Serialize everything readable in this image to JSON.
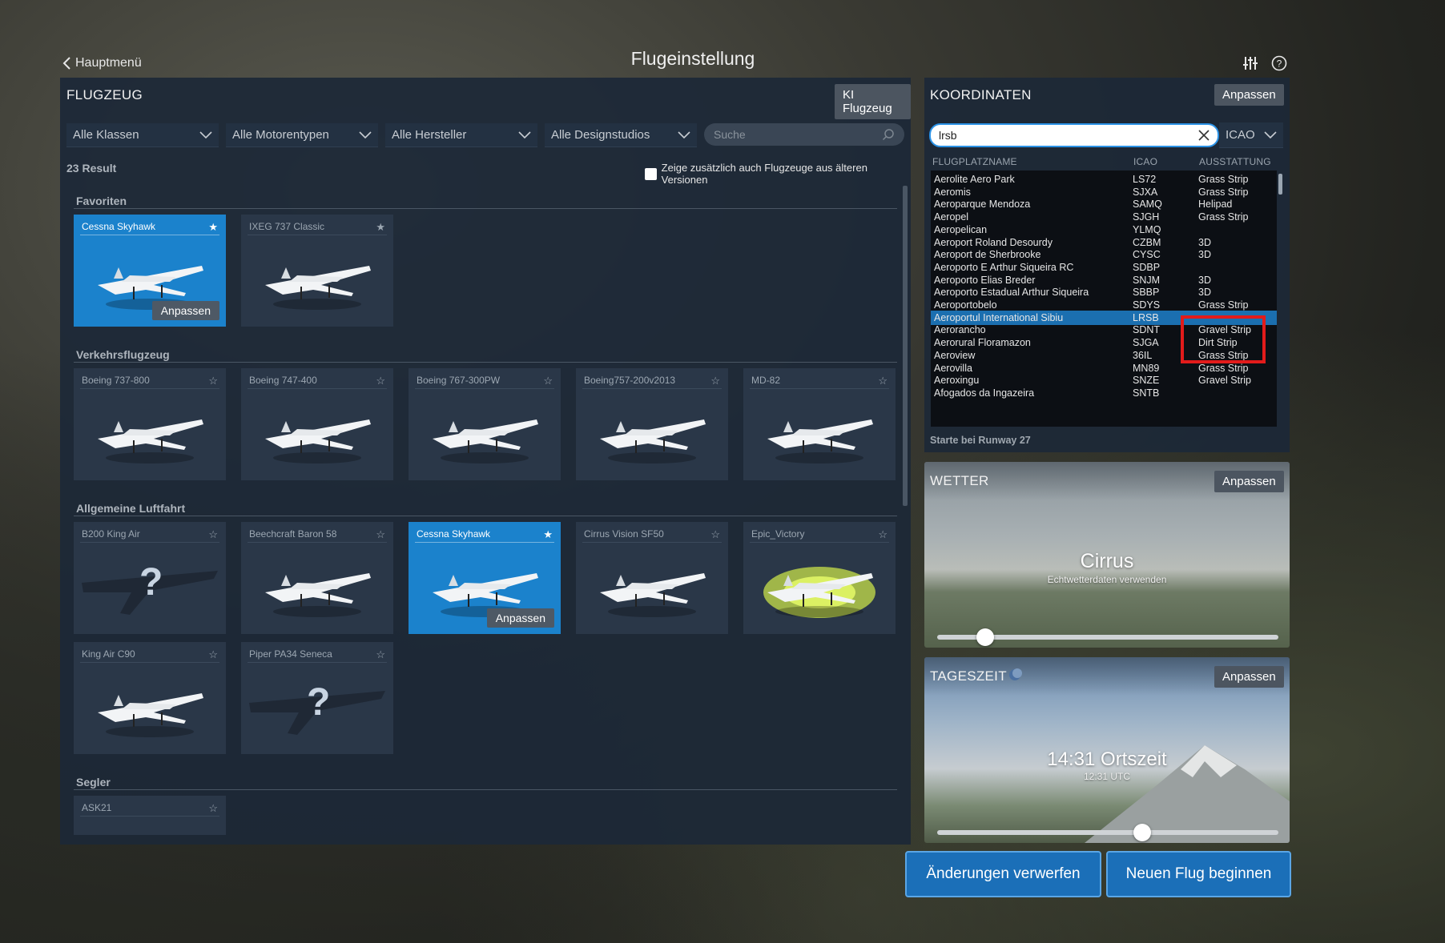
{
  "top": {
    "back_label": "Hauptmenü",
    "title": "Flugeinstellung"
  },
  "aircraft": {
    "header": "FLUGZEUG",
    "ai_button": "KI Flugzeug",
    "filters": [
      "Alle Klassen",
      "Alle Motorentypen",
      "Alle Hersteller",
      "Alle Designstudios"
    ],
    "search_placeholder": "Suche",
    "result_count": "23 Result",
    "older_versions_label": "Zeige zusätzlich auch Flugzeuge aus älteren Versionen",
    "older_versions_checked": false,
    "customize_label": "Anpassen",
    "sections": [
      {
        "title": "Favoriten",
        "cards": [
          {
            "name": "Cessna Skyhawk",
            "starred": true,
            "active": true,
            "image": "plane-cessna-icon"
          },
          {
            "name": "IXEG 737 Classic",
            "starred": true,
            "active": false,
            "image": "plane-airliner-icon"
          }
        ]
      },
      {
        "title": "Verkehrsflugzeug",
        "cards": [
          {
            "name": "Boeing 737-800",
            "starred": false,
            "active": false,
            "image": "plane-airliner-icon"
          },
          {
            "name": "Boeing 747-400",
            "starred": false,
            "active": false,
            "image": "plane-airliner-icon"
          },
          {
            "name": "Boeing 767-300PW",
            "starred": false,
            "active": false,
            "image": "plane-airliner-icon"
          },
          {
            "name": "Boeing757-200v2013",
            "starred": false,
            "active": false,
            "image": "plane-airliner-icon"
          },
          {
            "name": "MD-82",
            "starred": false,
            "active": false,
            "image": "plane-airliner-icon"
          }
        ]
      },
      {
        "title": "Allgemeine Luftfahrt",
        "cards": [
          {
            "name": "B200 King Air",
            "starred": false,
            "active": false,
            "image": "question-icon"
          },
          {
            "name": "Beechcraft Baron 58",
            "starred": false,
            "active": false,
            "image": "plane-twin-icon"
          },
          {
            "name": "Cessna Skyhawk",
            "starred": true,
            "active": true,
            "image": "plane-cessna-icon"
          },
          {
            "name": "Cirrus Vision SF50",
            "starred": false,
            "active": false,
            "image": "plane-jet-icon"
          },
          {
            "name": "Epic_Victory",
            "starred": false,
            "active": false,
            "image": "plane-jet-glow-icon"
          },
          {
            "name": "King Air C90",
            "starred": false,
            "active": false,
            "image": "plane-twin-icon"
          },
          {
            "name": "Piper PA34 Seneca",
            "starred": false,
            "active": false,
            "image": "question-icon"
          }
        ]
      },
      {
        "title": "Segler",
        "cards": [
          {
            "name": "ASK21",
            "starred": false,
            "active": false,
            "image": "glider-icon"
          }
        ]
      }
    ]
  },
  "coordinates": {
    "header": "KOORDINATEN",
    "customize_label": "Anpassen",
    "search_value": "lrsb",
    "code_select": "ICAO",
    "columns": [
      "FLUGPLATZNAME",
      "ICAO",
      "AUSSTATTUNG"
    ],
    "rows": [
      [
        "Aerolite Aero Park",
        "LS72",
        "Grass Strip"
      ],
      [
        "Aeromis",
        "SJXA",
        "Grass Strip"
      ],
      [
        "Aeroparque Mendoza",
        "SAMQ",
        "Helipad"
      ],
      [
        "Aeropel",
        "SJGH",
        "Grass Strip"
      ],
      [
        "Aeropelican",
        "YLMQ",
        ""
      ],
      [
        "Aeroport Roland Desourdy",
        "CZBM",
        "3D"
      ],
      [
        "Aeroport de Sherbrooke",
        "CYSC",
        "3D"
      ],
      [
        "Aeroporto E Arthur Siqueira RC",
        "SDBP",
        ""
      ],
      [
        "Aeroporto Elias Breder",
        "SNJM",
        "3D"
      ],
      [
        "Aeroporto Estadual Arthur Siqueira",
        "SBBP",
        "3D"
      ],
      [
        "Aeroportobelo",
        "SDYS",
        "Grass Strip"
      ],
      [
        "Aeroportul International Sibiu",
        "LRSB",
        ""
      ],
      [
        "Aerorancho",
        "SDNT",
        "Gravel Strip"
      ],
      [
        "Aerorural Floramazon",
        "SJGA",
        "Dirt Strip"
      ],
      [
        "Aeroview",
        "36IL",
        "Grass Strip"
      ],
      [
        "Aerovilla",
        "MN89",
        "Grass Strip"
      ],
      [
        "Aeroxingu",
        "SNZE",
        "Gravel Strip"
      ],
      [
        "Afogados da Ingazeira",
        "SNTB",
        ""
      ]
    ],
    "selected_index": 11,
    "runway_note": "Starte bei Runway 27"
  },
  "weather": {
    "header": "WETTER",
    "customize_label": "Anpassen",
    "condition": "Cirrus",
    "subtitle": "Echtwetterdaten verwenden",
    "slider_level": 0.14
  },
  "timeofday": {
    "header": "TAGESZEIT",
    "customize_label": "Anpassen",
    "local_time": "14:31 Ortszeit",
    "utc_time": "12:31 UTC",
    "slider_level": 0.6
  },
  "actions": {
    "discard": "Änderungen verwerfen",
    "start": "Neuen Flug beginnen"
  },
  "colors": {
    "accent": "#1b82cc",
    "panel": "#1c2837",
    "highlight_box": "#e21b1b"
  }
}
